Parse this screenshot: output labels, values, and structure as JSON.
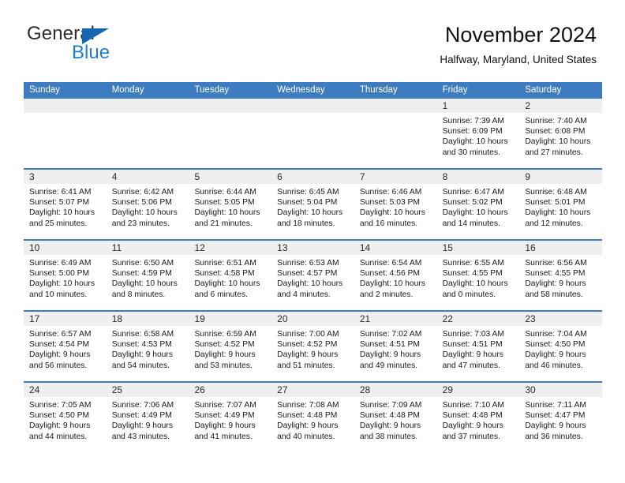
{
  "brand": {
    "name_part1": "General",
    "name_part2": "Blue",
    "triangle_color": "#1565b0",
    "blue_text_color": "#1f7fd0"
  },
  "header": {
    "title": "November 2024",
    "subtitle": "Halfway, Maryland, United States"
  },
  "colors": {
    "header_blue": "#3d7cbe",
    "day_band_gray": "#efefef",
    "text": "#1a1a1a"
  },
  "weekdays": [
    "Sunday",
    "Monday",
    "Tuesday",
    "Wednesday",
    "Thursday",
    "Friday",
    "Saturday"
  ],
  "weeks": [
    [
      {
        "day": "",
        "lines": []
      },
      {
        "day": "",
        "lines": []
      },
      {
        "day": "",
        "lines": []
      },
      {
        "day": "",
        "lines": []
      },
      {
        "day": "",
        "lines": []
      },
      {
        "day": "1",
        "lines": [
          "Sunrise: 7:39 AM",
          "Sunset: 6:09 PM",
          "Daylight: 10 hours",
          "and 30 minutes."
        ]
      },
      {
        "day": "2",
        "lines": [
          "Sunrise: 7:40 AM",
          "Sunset: 6:08 PM",
          "Daylight: 10 hours",
          "and 27 minutes."
        ]
      }
    ],
    [
      {
        "day": "3",
        "lines": [
          "Sunrise: 6:41 AM",
          "Sunset: 5:07 PM",
          "Daylight: 10 hours",
          "and 25 minutes."
        ]
      },
      {
        "day": "4",
        "lines": [
          "Sunrise: 6:42 AM",
          "Sunset: 5:06 PM",
          "Daylight: 10 hours",
          "and 23 minutes."
        ]
      },
      {
        "day": "5",
        "lines": [
          "Sunrise: 6:44 AM",
          "Sunset: 5:05 PM",
          "Daylight: 10 hours",
          "and 21 minutes."
        ]
      },
      {
        "day": "6",
        "lines": [
          "Sunrise: 6:45 AM",
          "Sunset: 5:04 PM",
          "Daylight: 10 hours",
          "and 18 minutes."
        ]
      },
      {
        "day": "7",
        "lines": [
          "Sunrise: 6:46 AM",
          "Sunset: 5:03 PM",
          "Daylight: 10 hours",
          "and 16 minutes."
        ]
      },
      {
        "day": "8",
        "lines": [
          "Sunrise: 6:47 AM",
          "Sunset: 5:02 PM",
          "Daylight: 10 hours",
          "and 14 minutes."
        ]
      },
      {
        "day": "9",
        "lines": [
          "Sunrise: 6:48 AM",
          "Sunset: 5:01 PM",
          "Daylight: 10 hours",
          "and 12 minutes."
        ]
      }
    ],
    [
      {
        "day": "10",
        "lines": [
          "Sunrise: 6:49 AM",
          "Sunset: 5:00 PM",
          "Daylight: 10 hours",
          "and 10 minutes."
        ]
      },
      {
        "day": "11",
        "lines": [
          "Sunrise: 6:50 AM",
          "Sunset: 4:59 PM",
          "Daylight: 10 hours",
          "and 8 minutes."
        ]
      },
      {
        "day": "12",
        "lines": [
          "Sunrise: 6:51 AM",
          "Sunset: 4:58 PM",
          "Daylight: 10 hours",
          "and 6 minutes."
        ]
      },
      {
        "day": "13",
        "lines": [
          "Sunrise: 6:53 AM",
          "Sunset: 4:57 PM",
          "Daylight: 10 hours",
          "and 4 minutes."
        ]
      },
      {
        "day": "14",
        "lines": [
          "Sunrise: 6:54 AM",
          "Sunset: 4:56 PM",
          "Daylight: 10 hours",
          "and 2 minutes."
        ]
      },
      {
        "day": "15",
        "lines": [
          "Sunrise: 6:55 AM",
          "Sunset: 4:55 PM",
          "Daylight: 10 hours",
          "and 0 minutes."
        ]
      },
      {
        "day": "16",
        "lines": [
          "Sunrise: 6:56 AM",
          "Sunset: 4:55 PM",
          "Daylight: 9 hours",
          "and 58 minutes."
        ]
      }
    ],
    [
      {
        "day": "17",
        "lines": [
          "Sunrise: 6:57 AM",
          "Sunset: 4:54 PM",
          "Daylight: 9 hours",
          "and 56 minutes."
        ]
      },
      {
        "day": "18",
        "lines": [
          "Sunrise: 6:58 AM",
          "Sunset: 4:53 PM",
          "Daylight: 9 hours",
          "and 54 minutes."
        ]
      },
      {
        "day": "19",
        "lines": [
          "Sunrise: 6:59 AM",
          "Sunset: 4:52 PM",
          "Daylight: 9 hours",
          "and 53 minutes."
        ]
      },
      {
        "day": "20",
        "lines": [
          "Sunrise: 7:00 AM",
          "Sunset: 4:52 PM",
          "Daylight: 9 hours",
          "and 51 minutes."
        ]
      },
      {
        "day": "21",
        "lines": [
          "Sunrise: 7:02 AM",
          "Sunset: 4:51 PM",
          "Daylight: 9 hours",
          "and 49 minutes."
        ]
      },
      {
        "day": "22",
        "lines": [
          "Sunrise: 7:03 AM",
          "Sunset: 4:51 PM",
          "Daylight: 9 hours",
          "and 47 minutes."
        ]
      },
      {
        "day": "23",
        "lines": [
          "Sunrise: 7:04 AM",
          "Sunset: 4:50 PM",
          "Daylight: 9 hours",
          "and 46 minutes."
        ]
      }
    ],
    [
      {
        "day": "24",
        "lines": [
          "Sunrise: 7:05 AM",
          "Sunset: 4:50 PM",
          "Daylight: 9 hours",
          "and 44 minutes."
        ]
      },
      {
        "day": "25",
        "lines": [
          "Sunrise: 7:06 AM",
          "Sunset: 4:49 PM",
          "Daylight: 9 hours",
          "and 43 minutes."
        ]
      },
      {
        "day": "26",
        "lines": [
          "Sunrise: 7:07 AM",
          "Sunset: 4:49 PM",
          "Daylight: 9 hours",
          "and 41 minutes."
        ]
      },
      {
        "day": "27",
        "lines": [
          "Sunrise: 7:08 AM",
          "Sunset: 4:48 PM",
          "Daylight: 9 hours",
          "and 40 minutes."
        ]
      },
      {
        "day": "28",
        "lines": [
          "Sunrise: 7:09 AM",
          "Sunset: 4:48 PM",
          "Daylight: 9 hours",
          "and 38 minutes."
        ]
      },
      {
        "day": "29",
        "lines": [
          "Sunrise: 7:10 AM",
          "Sunset: 4:48 PM",
          "Daylight: 9 hours",
          "and 37 minutes."
        ]
      },
      {
        "day": "30",
        "lines": [
          "Sunrise: 7:11 AM",
          "Sunset: 4:47 PM",
          "Daylight: 9 hours",
          "and 36 minutes."
        ]
      }
    ]
  ]
}
